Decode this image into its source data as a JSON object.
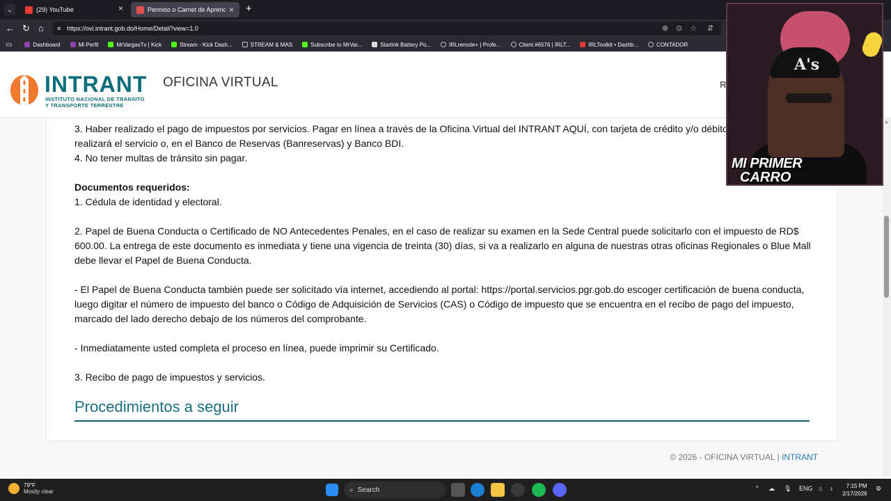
{
  "browser": {
    "tabs": [
      {
        "label": "(29) YouTube",
        "favicon_color": "#e53935"
      },
      {
        "label": "Permiso o Carnet de Aprendizaje I",
        "favicon_color": "#e0504e"
      }
    ],
    "url": "https://ovi.intrant.gob.do/Home/Detail?view=1.0",
    "bookmarks": [
      {
        "label": "Dashboard",
        "color": "#8e44ad"
      },
      {
        "label": "Mi Perfil",
        "color": "#8e44ad"
      },
      {
        "label": "MrVargasTv | Kick",
        "color": "#53fc18"
      },
      {
        "label": "Stream - Kick Dash...",
        "color": "#53fc18"
      },
      {
        "label": "STREAM & MAS",
        "color": "#cccccc"
      },
      {
        "label": "Subscribe to MrVar...",
        "color": "#53fc18"
      },
      {
        "label": "Starlink Battery Po...",
        "color": "#dddddd"
      },
      {
        "label": "IRLremote+ | Profe...",
        "color": "#bbbbbb"
      },
      {
        "label": "Client #6576 | IRLT...",
        "color": "#bbbbbb"
      },
      {
        "label": "IRLToolkit • Dashb...",
        "color": "#e53935"
      },
      {
        "label": "CONTADOR",
        "color": "#bbbbbb"
      }
    ]
  },
  "site": {
    "logo_name": "INTRANT",
    "logo_sub1": "INSTITUTO NACIONAL DE TRÁNSITO",
    "logo_sub2": "Y TRANSPORTE TERRESTRE",
    "office_title": "OFICINA VIRTUAL",
    "nav_partial": "R",
    "brand_color": "#0e6f7c"
  },
  "content": {
    "req3": "3. Haber realizado el pago de impuestos por servicios. Pagar en línea a través de la Oficina Virtual del INTRANT AQUÍ, con tarjeta de crédito y/o débito en la Sede donde realizará el servicio o, en el Banco de Reservas (Banreservas) y Banco BDI.",
    "req4": "4. No tener multas de tránsito sin pagar.",
    "docs_heading": "Documentos requeridos:",
    "doc1": "1. Cédula de identidad y electoral.",
    "doc2": "2. Papel de Buena Conducta o Certificado de NO Antecedentes Penales, en el caso de realizar su examen en la Sede Central puede solicitarlo con el impuesto de RD$ 600.00. La entrega de este documento es inmediata y tiene una vigencia de treinta (30) días, si va a realizarlo en alguna de nuestras otras oficinas Regionales o Blue Mall debe llevar el Papel de Buena Conducta.",
    "note1": "- El Papel de Buena Conducta también puede ser solicitado vía internet, accediendo al portal: https://portal.servicios.pgr.gob.do escoger certificación de buena conducta, luego digitar el número de impuesto del banco o Código de Adquisición de Servicios (CAS) o Código de impuesto que se encuentra en el recibo de pago del impuesto, marcado del lado derecho debajo de los números del comprobante.",
    "note2": "- Inmediatamente usted completa el proceso en línea, puede imprimir su Certificado.",
    "doc3": "3. Recibo de pago de impuestos y servicios.",
    "section_title": "Procedimientos a seguir"
  },
  "footer": {
    "text": "© 2026 - OFICINA VIRTUAL | ",
    "link": "INTRANT"
  },
  "webcam": {
    "title_line1": "MI PRIMER",
    "title_line2": "CARRO"
  },
  "taskbar": {
    "temp": "79°F",
    "weather": "Mostly clear",
    "search_label": "Search",
    "lang": "ENG",
    "time": "7:15 PM",
    "date": "2/17/2026"
  }
}
